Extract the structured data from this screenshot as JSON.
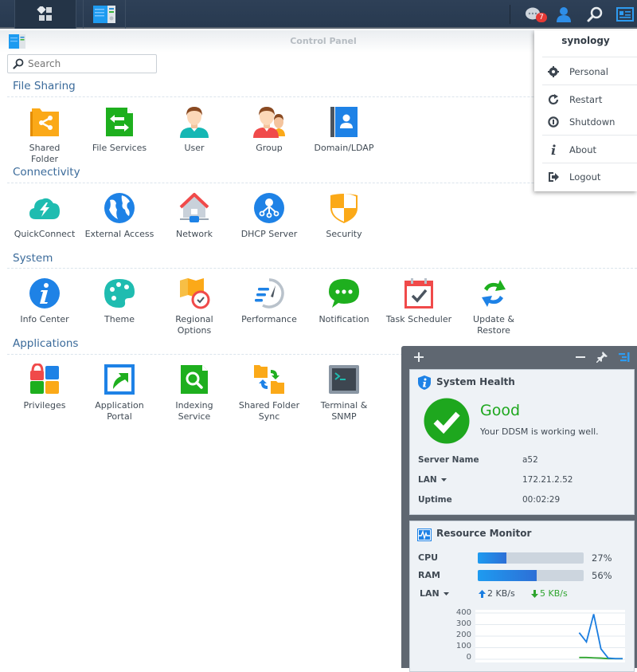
{
  "taskbar": {
    "notification_count": "7"
  },
  "window": {
    "title": "Control Panel",
    "search_placeholder": "Search"
  },
  "sections": [
    {
      "title": "File Sharing",
      "apps": [
        {
          "label": "Shared\nFolder",
          "icon": "shared-folder-icon"
        },
        {
          "label": "File Services",
          "icon": "file-services-icon"
        },
        {
          "label": "User",
          "icon": "user-icon"
        },
        {
          "label": "Group",
          "icon": "group-icon"
        },
        {
          "label": "Domain/LDAP",
          "icon": "domain-ldap-icon"
        }
      ]
    },
    {
      "title": "Connectivity",
      "apps": [
        {
          "label": "QuickConnect",
          "icon": "quickconnect-icon"
        },
        {
          "label": "External Access",
          "icon": "external-access-icon"
        },
        {
          "label": "Network",
          "icon": "network-icon"
        },
        {
          "label": "DHCP Server",
          "icon": "dhcp-server-icon"
        },
        {
          "label": "Security",
          "icon": "security-icon"
        }
      ]
    },
    {
      "title": "System",
      "apps": [
        {
          "label": "Info Center",
          "icon": "info-center-icon"
        },
        {
          "label": "Theme",
          "icon": "theme-icon"
        },
        {
          "label": "Regional\nOptions",
          "icon": "regional-options-icon"
        },
        {
          "label": "Performance",
          "icon": "performance-icon"
        },
        {
          "label": "Notification",
          "icon": "notification-icon"
        },
        {
          "label": "Task Scheduler",
          "icon": "task-scheduler-icon"
        },
        {
          "label": "Update &\nRestore",
          "icon": "update-restore-icon"
        }
      ]
    },
    {
      "title": "Applications",
      "apps": [
        {
          "label": "Privileges",
          "icon": "privileges-icon"
        },
        {
          "label": "Application\nPortal",
          "icon": "application-portal-icon"
        },
        {
          "label": "Indexing\nService",
          "icon": "indexing-service-icon"
        },
        {
          "label": "Shared Folder\nSync",
          "icon": "shared-folder-sync-icon"
        },
        {
          "label": "Terminal &\nSNMP",
          "icon": "terminal-snmp-icon"
        }
      ]
    }
  ],
  "user_menu": {
    "username": "synology",
    "items": [
      {
        "label": "Personal",
        "icon": "gear-icon"
      },
      {
        "label": "Restart",
        "icon": "restart-icon"
      },
      {
        "label": "Shutdown",
        "icon": "power-icon"
      },
      {
        "label": "About",
        "icon": "info-icon"
      },
      {
        "label": "Logout",
        "icon": "logout-icon"
      }
    ]
  },
  "system_health": {
    "title": "System Health",
    "status": "Good",
    "message": "Your DDSM is working well.",
    "status_color": "#1ea71e",
    "rows": [
      {
        "key": "Server Name",
        "value": "a52"
      },
      {
        "key": "LAN",
        "value": "172.21.2.52",
        "dropdown": true
      },
      {
        "key": "Uptime",
        "value": "00:02:29"
      }
    ]
  },
  "resource_monitor": {
    "title": "Resource Monitor",
    "cpu_label": "CPU",
    "cpu_percent": 27,
    "cpu_text": "27%",
    "ram_label": "RAM",
    "ram_percent": 56,
    "ram_text": "56%",
    "lan_label": "LAN",
    "upload": "2 KB/s",
    "download": "5 KB/s",
    "upload_color": "#1a7de0",
    "download_color": "#2fa52f"
  },
  "chart_data": {
    "type": "line",
    "title": "",
    "xlabel": "",
    "ylabel": "",
    "ylim": [
      0,
      400
    ],
    "yticks": [
      "400",
      "300",
      "200",
      "100",
      "0"
    ],
    "grid": true,
    "x": [
      0,
      1,
      2,
      3,
      4,
      5,
      6,
      7,
      8,
      9,
      10,
      11,
      12,
      13,
      14,
      15,
      16,
      17,
      18,
      19,
      20
    ],
    "series": [
      {
        "name": "Upload",
        "color": "#1a7de0",
        "values": [
          null,
          null,
          null,
          null,
          null,
          null,
          null,
          null,
          null,
          null,
          null,
          null,
          null,
          null,
          230,
          150,
          390,
          90,
          10,
          5,
          5
        ]
      },
      {
        "name": "Download",
        "color": "#2fa52f",
        "values": [
          null,
          null,
          null,
          null,
          null,
          null,
          null,
          null,
          null,
          null,
          null,
          null,
          null,
          null,
          15,
          15,
          12,
          10,
          5,
          5,
          5
        ]
      }
    ]
  }
}
